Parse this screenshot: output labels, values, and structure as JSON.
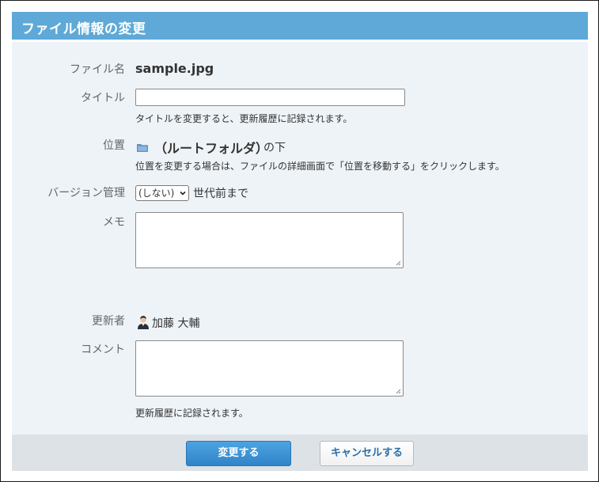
{
  "dialog": {
    "title": "ファイル情報の変更"
  },
  "form": {
    "filename": {
      "label": "ファイル名",
      "value": "sample.jpg"
    },
    "title": {
      "label": "タイトル",
      "value": "",
      "hint": "タイトルを変更すると、更新履歴に記録されます。"
    },
    "location": {
      "label": "位置",
      "folder_name": "（ルートフォルダ）",
      "suffix": "の下",
      "folder_icon": "folder-icon",
      "hint": "位置を変更する場合は、ファイルの詳細画面で「位置を移動する」をクリックします。"
    },
    "version": {
      "label": "バージョン管理",
      "selected": "(しない)",
      "suffix": "世代前まで"
    },
    "memo": {
      "label": "メモ",
      "value": ""
    },
    "updater": {
      "label": "更新者",
      "name": "加藤 大輔",
      "avatar_icon": "user-avatar-icon"
    },
    "comment": {
      "label": "コメント",
      "value": "",
      "hint": "更新履歴に記録されます。"
    }
  },
  "footer": {
    "submit_label": "変更する",
    "cancel_label": "キャンセルする"
  },
  "colors": {
    "title_bar": "#5ea9d7",
    "panel_bg": "#eef3f7",
    "footer_bg": "#dde2e6",
    "primary_button": "#3a8fd3",
    "folder_icon": "#6b98c9"
  }
}
